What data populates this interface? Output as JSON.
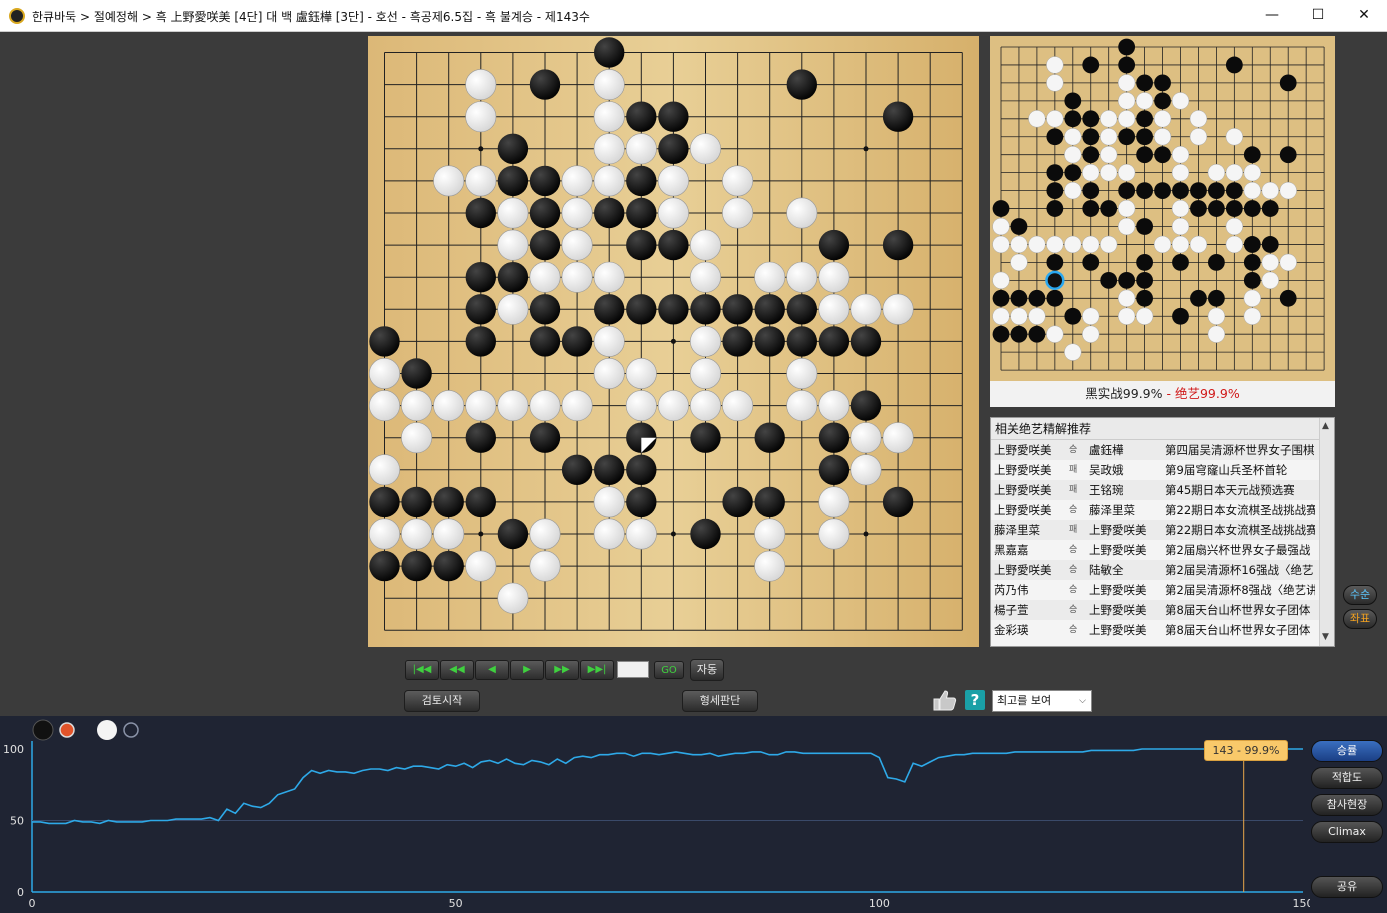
{
  "window": {
    "title": "한큐바둑 > 절예정해 > 흑 上野愛咲美 [4단] 대 백 盧鈺樺 [3단] - 호선 - 흑공제6.5집 - 흑 불계승 - 제143수",
    "minimize": "—",
    "maximize": "☐",
    "close": "✕"
  },
  "main_board": {
    "size": 19,
    "stars": [
      [
        3,
        3
      ],
      [
        3,
        9
      ],
      [
        3,
        15
      ],
      [
        9,
        3
      ],
      [
        9,
        9
      ],
      [
        9,
        15
      ],
      [
        15,
        3
      ],
      [
        15,
        9
      ],
      [
        15,
        15
      ]
    ],
    "black": [
      [
        0,
        7
      ],
      [
        1,
        5
      ],
      [
        1,
        7
      ],
      [
        1,
        13
      ],
      [
        2,
        8
      ],
      [
        2,
        9
      ],
      [
        2,
        16
      ],
      [
        3,
        4
      ],
      [
        3,
        9
      ],
      [
        4,
        4
      ],
      [
        4,
        5
      ],
      [
        4,
        8
      ],
      [
        5,
        3
      ],
      [
        5,
        5
      ],
      [
        5,
        7
      ],
      [
        5,
        8
      ],
      [
        5,
        9
      ],
      [
        6,
        5
      ],
      [
        6,
        8
      ],
      [
        6,
        9
      ],
      [
        6,
        14
      ],
      [
        6,
        16
      ],
      [
        7,
        3
      ],
      [
        7,
        4
      ],
      [
        8,
        3
      ],
      [
        8,
        5
      ],
      [
        8,
        7
      ],
      [
        8,
        8
      ],
      [
        8,
        9
      ],
      [
        8,
        10
      ],
      [
        8,
        11
      ],
      [
        8,
        12
      ],
      [
        8,
        13
      ],
      [
        9,
        0
      ],
      [
        9,
        3
      ],
      [
        9,
        5
      ],
      [
        9,
        6
      ],
      [
        9,
        11
      ],
      [
        9,
        12
      ],
      [
        9,
        13
      ],
      [
        9,
        14
      ],
      [
        9,
        15
      ],
      [
        10,
        1
      ],
      [
        10,
        8
      ],
      [
        11,
        14
      ],
      [
        11,
        15
      ],
      [
        12,
        3
      ],
      [
        12,
        5
      ],
      [
        12,
        8
      ],
      [
        12,
        10
      ],
      [
        12,
        12
      ],
      [
        12,
        14
      ],
      [
        13,
        6
      ],
      [
        13,
        7
      ],
      [
        13,
        8
      ],
      [
        13,
        14
      ],
      [
        14,
        0
      ],
      [
        14,
        1
      ],
      [
        14,
        2
      ],
      [
        14,
        3
      ],
      [
        14,
        8
      ],
      [
        14,
        11
      ],
      [
        14,
        12
      ],
      [
        14,
        16
      ],
      [
        15,
        4
      ],
      [
        15,
        10
      ],
      [
        16,
        0
      ],
      [
        16,
        1
      ],
      [
        16,
        2
      ]
    ],
    "white": [
      [
        1,
        3
      ],
      [
        1,
        7
      ],
      [
        2,
        3
      ],
      [
        2,
        7
      ],
      [
        3,
        7
      ],
      [
        3,
        8
      ],
      [
        3,
        10
      ],
      [
        4,
        2
      ],
      [
        4,
        3
      ],
      [
        4,
        6
      ],
      [
        4,
        7
      ],
      [
        4,
        9
      ],
      [
        4,
        11
      ],
      [
        5,
        4
      ],
      [
        5,
        6
      ],
      [
        5,
        9
      ],
      [
        5,
        11
      ],
      [
        5,
        13
      ],
      [
        6,
        4
      ],
      [
        6,
        6
      ],
      [
        6,
        10
      ],
      [
        7,
        5
      ],
      [
        7,
        6
      ],
      [
        7,
        7
      ],
      [
        7,
        10
      ],
      [
        7,
        12
      ],
      [
        7,
        13
      ],
      [
        7,
        14
      ],
      [
        8,
        4
      ],
      [
        8,
        14
      ],
      [
        8,
        15
      ],
      [
        8,
        16
      ],
      [
        9,
        7
      ],
      [
        9,
        10
      ],
      [
        10,
        0
      ],
      [
        10,
        7
      ],
      [
        10,
        8
      ],
      [
        10,
        10
      ],
      [
        10,
        13
      ],
      [
        11,
        0
      ],
      [
        11,
        1
      ],
      [
        11,
        2
      ],
      [
        11,
        3
      ],
      [
        11,
        4
      ],
      [
        11,
        5
      ],
      [
        11,
        6
      ],
      [
        11,
        8
      ],
      [
        11,
        9
      ],
      [
        11,
        10
      ],
      [
        11,
        11
      ],
      [
        11,
        13
      ],
      [
        11,
        14
      ],
      [
        12,
        1
      ],
      [
        12,
        15
      ],
      [
        12,
        16
      ],
      [
        13,
        0
      ],
      [
        13,
        15
      ],
      [
        14,
        7
      ],
      [
        14,
        14
      ],
      [
        15,
        0
      ],
      [
        15,
        1
      ],
      [
        15,
        2
      ],
      [
        15,
        5
      ],
      [
        15,
        7
      ],
      [
        15,
        8
      ],
      [
        15,
        12
      ],
      [
        15,
        14
      ],
      [
        16,
        3
      ],
      [
        16,
        5
      ],
      [
        16,
        12
      ],
      [
        17,
        4
      ]
    ],
    "last_move": [
      12,
      8
    ]
  },
  "mini_board": {
    "size": 19,
    "black": [
      [
        0,
        7
      ],
      [
        1,
        5
      ],
      [
        1,
        7
      ],
      [
        1,
        13
      ],
      [
        2,
        8
      ],
      [
        2,
        9
      ],
      [
        2,
        16
      ],
      [
        3,
        4
      ],
      [
        3,
        9
      ],
      [
        4,
        4
      ],
      [
        4,
        5
      ],
      [
        4,
        8
      ],
      [
        5,
        3
      ],
      [
        5,
        5
      ],
      [
        5,
        7
      ],
      [
        5,
        8
      ],
      [
        5,
        9
      ],
      [
        6,
        5
      ],
      [
        6,
        8
      ],
      [
        6,
        9
      ],
      [
        6,
        14
      ],
      [
        6,
        16
      ],
      [
        7,
        3
      ],
      [
        7,
        4
      ],
      [
        8,
        3
      ],
      [
        8,
        5
      ],
      [
        8,
        7
      ],
      [
        8,
        8
      ],
      [
        8,
        9
      ],
      [
        8,
        10
      ],
      [
        8,
        11
      ],
      [
        8,
        12
      ],
      [
        8,
        13
      ],
      [
        9,
        0
      ],
      [
        9,
        3
      ],
      [
        9,
        5
      ],
      [
        9,
        6
      ],
      [
        9,
        11
      ],
      [
        9,
        12
      ],
      [
        9,
        13
      ],
      [
        9,
        14
      ],
      [
        9,
        15
      ],
      [
        10,
        1
      ],
      [
        10,
        8
      ],
      [
        11,
        14
      ],
      [
        11,
        15
      ],
      [
        12,
        3
      ],
      [
        12,
        5
      ],
      [
        12,
        8
      ],
      [
        12,
        10
      ],
      [
        12,
        12
      ],
      [
        12,
        14
      ],
      [
        13,
        6
      ],
      [
        13,
        7
      ],
      [
        13,
        8
      ],
      [
        13,
        14
      ],
      [
        14,
        0
      ],
      [
        14,
        1
      ],
      [
        14,
        2
      ],
      [
        14,
        3
      ],
      [
        14,
        8
      ],
      [
        14,
        11
      ],
      [
        14,
        12
      ],
      [
        14,
        16
      ],
      [
        15,
        4
      ],
      [
        15,
        10
      ],
      [
        16,
        0
      ],
      [
        16,
        1
      ],
      [
        16,
        2
      ]
    ],
    "white": [
      [
        1,
        3
      ],
      [
        2,
        3
      ],
      [
        2,
        7
      ],
      [
        3,
        7
      ],
      [
        3,
        8
      ],
      [
        3,
        10
      ],
      [
        4,
        2
      ],
      [
        4,
        3
      ],
      [
        4,
        6
      ],
      [
        4,
        7
      ],
      [
        4,
        9
      ],
      [
        4,
        11
      ],
      [
        5,
        4
      ],
      [
        5,
        6
      ],
      [
        5,
        9
      ],
      [
        5,
        11
      ],
      [
        5,
        13
      ],
      [
        6,
        4
      ],
      [
        6,
        6
      ],
      [
        6,
        10
      ],
      [
        7,
        5
      ],
      [
        7,
        6
      ],
      [
        7,
        7
      ],
      [
        7,
        10
      ],
      [
        7,
        12
      ],
      [
        7,
        13
      ],
      [
        7,
        14
      ],
      [
        8,
        4
      ],
      [
        8,
        14
      ],
      [
        8,
        15
      ],
      [
        8,
        16
      ],
      [
        9,
        7
      ],
      [
        9,
        10
      ],
      [
        10,
        0
      ],
      [
        10,
        7
      ],
      [
        10,
        10
      ],
      [
        10,
        13
      ],
      [
        11,
        0
      ],
      [
        11,
        1
      ],
      [
        11,
        2
      ],
      [
        11,
        3
      ],
      [
        11,
        4
      ],
      [
        11,
        5
      ],
      [
        11,
        6
      ],
      [
        11,
        9
      ],
      [
        11,
        10
      ],
      [
        11,
        11
      ],
      [
        11,
        13
      ],
      [
        12,
        1
      ],
      [
        12,
        15
      ],
      [
        12,
        16
      ],
      [
        13,
        0
      ],
      [
        13,
        15
      ],
      [
        14,
        7
      ],
      [
        14,
        14
      ],
      [
        15,
        0
      ],
      [
        15,
        1
      ],
      [
        15,
        2
      ],
      [
        15,
        5
      ],
      [
        15,
        7
      ],
      [
        15,
        8
      ],
      [
        15,
        12
      ],
      [
        15,
        14
      ],
      [
        16,
        3
      ],
      [
        16,
        5
      ],
      [
        16,
        12
      ],
      [
        17,
        4
      ]
    ],
    "highlight": [
      13,
      3
    ]
  },
  "winrate_banner": {
    "left": "黑实战99.9%",
    "sep": " - ",
    "right": "绝艺99.9%",
    "right_color": "#d01818"
  },
  "recommend": {
    "header": "相关绝艺精解推荐",
    "rows": [
      {
        "a": "上野愛咲美",
        "r": "승",
        "b": "盧鈺樺",
        "event": "第四届吴清源杯世界女子围棋"
      },
      {
        "a": "上野愛咲美",
        "r": "패",
        "b": "吴政娥",
        "event": "第9届穹窿山兵圣杯首轮"
      },
      {
        "a": "上野愛咲美",
        "r": "패",
        "b": "王铭琬",
        "event": "第45期日本天元战预选赛"
      },
      {
        "a": "上野愛咲美",
        "r": "승",
        "b": "藤泽里菜",
        "event": "第22期日本女流棋圣战挑战赛"
      },
      {
        "a": "藤泽里菜",
        "r": "패",
        "b": "上野愛咲美",
        "event": "第22期日本女流棋圣战挑战赛"
      },
      {
        "a": "黑嘉嘉",
        "r": "승",
        "b": "上野愛咲美",
        "event": "第2届扇兴杯世界女子最强战"
      },
      {
        "a": "上野愛咲美",
        "r": "승",
        "b": "陆敏全",
        "event": "第2届吴清源杯16强战〈绝艺"
      },
      {
        "a": "芮乃伟",
        "r": "승",
        "b": "上野愛咲美",
        "event": "第2届吴清源杯8强战〈绝艺讲"
      },
      {
        "a": "楊子萱",
        "r": "승",
        "b": "上野愛咲美",
        "event": "第8届天台山杯世界女子团体"
      },
      {
        "a": "金彩瑛",
        "r": "승",
        "b": "上野愛咲美",
        "event": "第8届天台山杯世界女子团体"
      }
    ]
  },
  "controls": {
    "first": "|◀◀",
    "prev10": "◀◀",
    "prev": "◀",
    "next": "▶",
    "next10": "▶▶",
    "last": "▶▶|",
    "go": "GO",
    "auto": "자동",
    "review_start": "검토시작",
    "situation": "형세판단",
    "help": "?",
    "best_select": "최고를 보여",
    "side_move_order": "수순",
    "side_coords": "좌표"
  },
  "chart_data": {
    "type": "line",
    "ylabel_ticks": [
      "100",
      "50",
      "0"
    ],
    "x_ticks": [
      "0",
      "50",
      "100",
      "150"
    ],
    "xlim": [
      0,
      150
    ],
    "ylim": [
      0,
      100
    ],
    "line_color": "#2ea9e8",
    "tooltip": "143 - 99.9%",
    "current_move": 143,
    "series": [
      {
        "values": [
          49,
          49,
          48,
          48,
          48,
          50,
          49,
          49,
          48,
          50,
          49,
          49,
          49,
          49,
          50,
          50,
          50,
          51,
          51,
          51,
          51,
          52,
          50,
          58,
          55,
          62,
          60,
          59,
          62,
          68,
          70,
          72,
          80,
          85,
          83,
          85,
          84,
          84,
          83,
          85,
          86,
          86,
          85,
          87,
          86,
          88,
          88,
          87,
          86,
          89,
          88,
          90,
          87,
          91,
          92,
          90,
          93,
          90,
          89,
          92,
          91,
          89,
          93,
          90,
          94,
          95,
          94,
          96,
          96,
          97,
          97,
          95,
          97,
          97,
          96,
          97,
          98,
          97,
          96,
          96,
          97,
          95,
          96,
          97,
          97,
          98,
          98,
          96,
          96,
          98,
          98,
          97,
          97,
          97,
          97,
          97,
          97,
          97,
          97,
          97,
          94,
          80,
          79,
          77,
          90,
          88,
          91,
          94,
          95,
          96,
          96,
          97,
          97,
          97,
          97,
          97,
          98,
          98,
          98,
          98,
          98,
          98,
          98,
          98,
          98,
          99,
          99,
          99,
          99,
          99,
          99,
          100,
          100,
          100,
          100,
          100,
          100,
          100,
          100,
          100,
          100,
          100,
          100,
          100,
          100,
          100,
          100,
          100,
          100,
          100,
          100
        ]
      }
    ]
  },
  "chart_buttons": {
    "win_rate": "승률",
    "accuracy": "적합도",
    "tragedy": "참사현장",
    "climax": "Climax",
    "share": "공유"
  }
}
